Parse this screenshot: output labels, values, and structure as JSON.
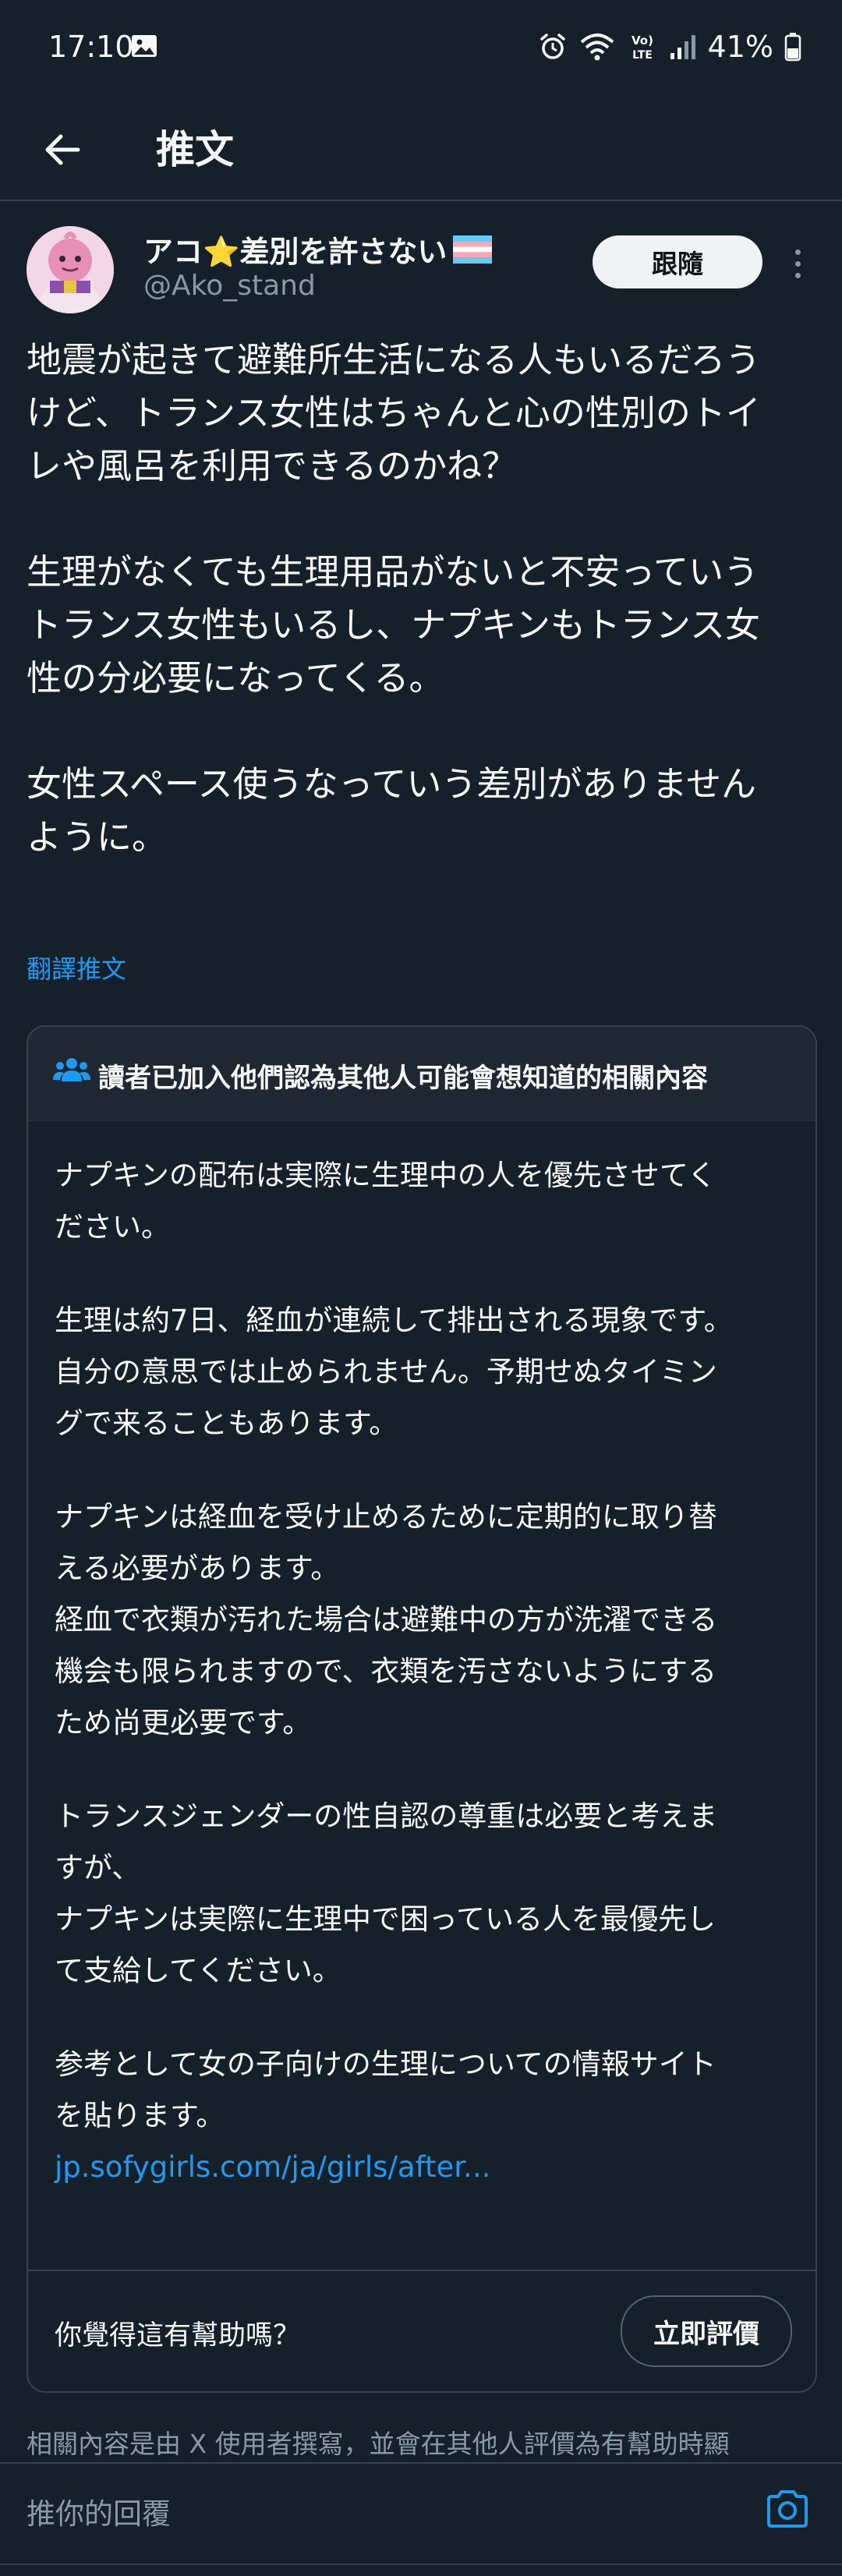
{
  "status_bar": {
    "time": "17:10",
    "battery": "41%",
    "network_label_top": "Vo)",
    "network_label_bottom": "LTE"
  },
  "app_bar": {
    "title": "推文"
  },
  "tweet": {
    "author": {
      "display_name": "アコ⭐差別を許さない",
      "handle": "@Ako_stand",
      "flag_icon": "transgender-flag-icon"
    },
    "follow_label": "跟隨",
    "paragraphs": [
      [
        "地震が起きて避難所生活になる人もいるだろう",
        "けど、トランス女性はちゃんと心の性別のトイ",
        "レや風呂を利用できるのかね？"
      ],
      [
        "生理がなくても生理用品がないと不安っていう",
        "トランス女性もいるし、ナプキンもトランス女",
        "性の分必要になってくる。"
      ],
      [
        "女性スペース使うなっていう差別がありません",
        "ように。"
      ]
    ],
    "translate_label": "翻譯推文"
  },
  "community_note": {
    "header": "讀者已加入他們認為其他人可能會想知道的相關內容",
    "paragraphs": [
      [
        "ナプキンの配布は実際に生理中の人を優先させてく",
        "ださい。"
      ],
      [
        "生理は約7日、経血が連続して排出される現象です。",
        "自分の意思では止められません。予期せぬタイミン",
        "グで来ることもあります。"
      ],
      [
        "ナプキンは経血を受け止めるために定期的に取り替",
        "える必要があります。",
        "経血で衣類が汚れた場合は避難中の方が洗濯できる",
        "機会も限られますので、衣類を汚さないようにする",
        "ため尚更必要です。"
      ],
      [
        "トランスジェンダーの性自認の尊重は必要と考えま",
        "すが、",
        "ナプキンは実際に生理中で困っている人を最優先し",
        "て支給してください。"
      ],
      [
        "参考として女の子向けの生理についての情報サイト",
        "を貼ります。"
      ]
    ],
    "link": "jp.sofygirls.com/ja/girls/after...",
    "helpful_question": "你覺得這有幫助嗎？",
    "rate_label": "立即評價",
    "footer": "相關內容是由 X 使用者撰寫，並會在其他人評價為有幫助時顯"
  },
  "reply": {
    "placeholder": "推你的回覆"
  },
  "colors": {
    "background": "#15202b",
    "accent": "#1d9bf0",
    "text": "#f7f9f9",
    "muted": "#8b98a5",
    "border": "#38444d"
  }
}
